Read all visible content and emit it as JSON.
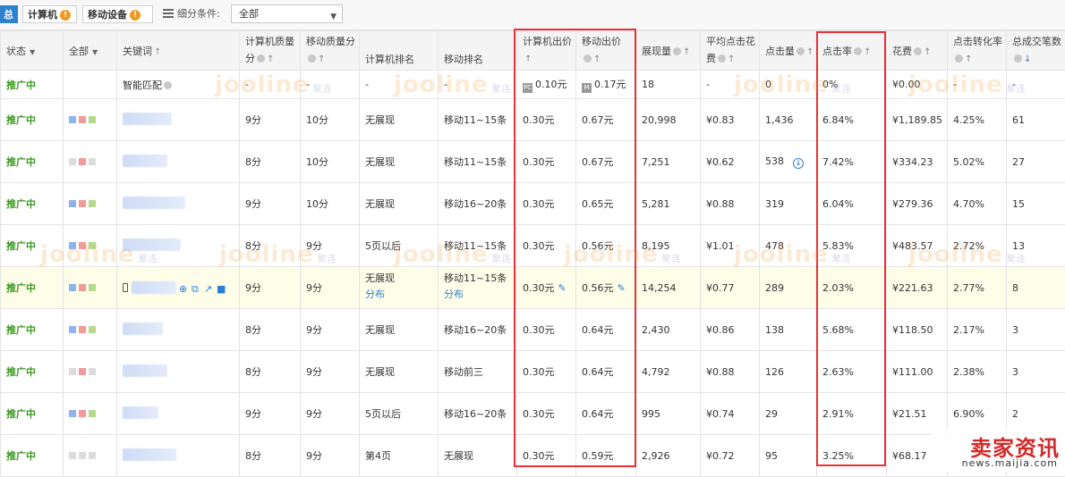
{
  "toolbar": {
    "tab_summary": "总",
    "tab_pc": "计算机",
    "tab_mobile": "移动设备",
    "warn_glyph": "!",
    "filter_label": "细分条件:",
    "filter_value": "全部"
  },
  "headers": {
    "status": "状态",
    "all": "全部",
    "keyword": "关键词",
    "pc_quality_1": "计算机质量",
    "pc_quality_2": "分",
    "mobile_quality": "移动质量分",
    "pc_rank": "计算机排名",
    "mobile_rank": "移动排名",
    "pc_bid": "计算机出价",
    "mobile_bid": "移动出价",
    "impressions": "展现量",
    "avg_cpc_1": "平均点击花",
    "avg_cpc_2": "费",
    "clicks": "点击量",
    "ctr": "点击率",
    "cost": "花费",
    "cvr": "点击转化率",
    "total_deals": "总成交笔数"
  },
  "smart_row": {
    "status": "推广中",
    "keyword": "智能匹配",
    "pc_quality": "-",
    "mobile_quality": "-",
    "pc_rank": "-",
    "mobile_rank": "-",
    "pc_bid": "0.10元",
    "mobile_bid": "0.17元",
    "impressions": "18",
    "avg_cpc": "-",
    "clicks": "0",
    "ctr": "0%",
    "cost": "¥0.00",
    "cvr": "-",
    "total_deals": "-"
  },
  "rows": [
    {
      "status": "推广中",
      "pc_quality": "9分",
      "mobile_quality": "10分",
      "pc_rank": "无展现",
      "pc_rank_sub": "",
      "mobile_rank": "移动11~15条",
      "mobile_rank_sub": "",
      "pc_bid": "0.30元",
      "mobile_bid": "0.67元",
      "impressions": "20,998",
      "avg_cpc": "¥0.83",
      "clicks": "1,436",
      "ctr": "6.84%",
      "cost": "¥1,189.85",
      "cvr": "4.25%",
      "total_deals": "61"
    },
    {
      "status": "推广中",
      "pc_quality": "8分",
      "mobile_quality": "10分",
      "pc_rank": "无展现",
      "pc_rank_sub": "",
      "mobile_rank": "移动11~15条",
      "mobile_rank_sub": "",
      "pc_bid": "0.30元",
      "mobile_bid": "0.67元",
      "impressions": "7,251",
      "avg_cpc": "¥0.62",
      "clicks": "538",
      "ctr": "7.42%",
      "cost": "¥334.23",
      "cvr": "5.02%",
      "total_deals": "27"
    },
    {
      "status": "推广中",
      "pc_quality": "9分",
      "mobile_quality": "10分",
      "pc_rank": "无展现",
      "pc_rank_sub": "",
      "mobile_rank": "移动16~20条",
      "mobile_rank_sub": "",
      "pc_bid": "0.30元",
      "mobile_bid": "0.65元",
      "impressions": "5,281",
      "avg_cpc": "¥0.88",
      "clicks": "319",
      "ctr": "6.04%",
      "cost": "¥279.36",
      "cvr": "4.70%",
      "total_deals": "15"
    },
    {
      "status": "推广中",
      "pc_quality": "8分",
      "mobile_quality": "9分",
      "pc_rank": "5页以后",
      "pc_rank_sub": "",
      "mobile_rank": "移动11~15条",
      "mobile_rank_sub": "",
      "pc_bid": "0.30元",
      "mobile_bid": "0.56元",
      "impressions": "8,195",
      "avg_cpc": "¥1.01",
      "clicks": "478",
      "ctr": "5.83%",
      "cost": "¥483.57",
      "cvr": "2.72%",
      "total_deals": "13"
    },
    {
      "status": "推广中",
      "pc_quality": "9分",
      "mobile_quality": "9分",
      "pc_rank": "无展现",
      "pc_rank_sub": "分布",
      "mobile_rank": "移动11~15条",
      "mobile_rank_sub": "分布",
      "pc_bid": "0.30元",
      "mobile_bid": "0.56元",
      "impressions": "14,254",
      "avg_cpc": "¥0.77",
      "clicks": "289",
      "ctr": "2.03%",
      "cost": "¥221.63",
      "cvr": "2.77%",
      "total_deals": "8"
    },
    {
      "status": "推广中",
      "pc_quality": "8分",
      "mobile_quality": "9分",
      "pc_rank": "无展现",
      "pc_rank_sub": "",
      "mobile_rank": "移动16~20条",
      "mobile_rank_sub": "",
      "pc_bid": "0.30元",
      "mobile_bid": "0.64元",
      "impressions": "2,430",
      "avg_cpc": "¥0.86",
      "clicks": "138",
      "ctr": "5.68%",
      "cost": "¥118.50",
      "cvr": "2.17%",
      "total_deals": "3"
    },
    {
      "status": "推广中",
      "pc_quality": "8分",
      "mobile_quality": "9分",
      "pc_rank": "无展现",
      "pc_rank_sub": "",
      "mobile_rank": "移动前三",
      "mobile_rank_sub": "",
      "pc_bid": "0.30元",
      "mobile_bid": "0.64元",
      "impressions": "4,792",
      "avg_cpc": "¥0.88",
      "clicks": "126",
      "ctr": "2.63%",
      "cost": "¥111.00",
      "cvr": "2.38%",
      "total_deals": "3"
    },
    {
      "status": "推广中",
      "pc_quality": "9分",
      "mobile_quality": "9分",
      "pc_rank": "5页以后",
      "pc_rank_sub": "",
      "mobile_rank": "移动16~20条",
      "mobile_rank_sub": "",
      "pc_bid": "0.30元",
      "mobile_bid": "0.64元",
      "impressions": "995",
      "avg_cpc": "¥0.74",
      "clicks": "29",
      "ctr": "2.91%",
      "cost": "¥21.51",
      "cvr": "6.90%",
      "total_deals": "2"
    },
    {
      "status": "推广中",
      "pc_quality": "8分",
      "mobile_quality": "9分",
      "pc_rank": "第4页",
      "pc_rank_sub": "",
      "mobile_rank": "无展现",
      "mobile_rank_sub": "",
      "pc_bid": "0.30元",
      "mobile_bid": "0.59元",
      "impressions": "2,926",
      "avg_cpc": "¥0.72",
      "clicks": "95",
      "ctr": "3.25%",
      "cost": "¥68.17",
      "cvr": "",
      "total_deals": ""
    }
  ],
  "watermark": {
    "text": "jooline",
    "sub": "聚连"
  },
  "brand": {
    "name": "卖家资讯",
    "url": "news.maijia.com"
  },
  "colors": {
    "status_green": "#3a9a1f",
    "highlight_red": "#e8313a",
    "link_blue": "#2a7fd6",
    "warn_orange": "#f39a1e"
  },
  "icons": [
    "list-icon",
    "warn-icon",
    "help-icon",
    "sort-up-icon",
    "sort-down-icon",
    "edit-pencil-icon",
    "download-icon",
    "globe-icon",
    "copy-icon",
    "chart-icon",
    "trash-icon",
    "phone-icon"
  ]
}
